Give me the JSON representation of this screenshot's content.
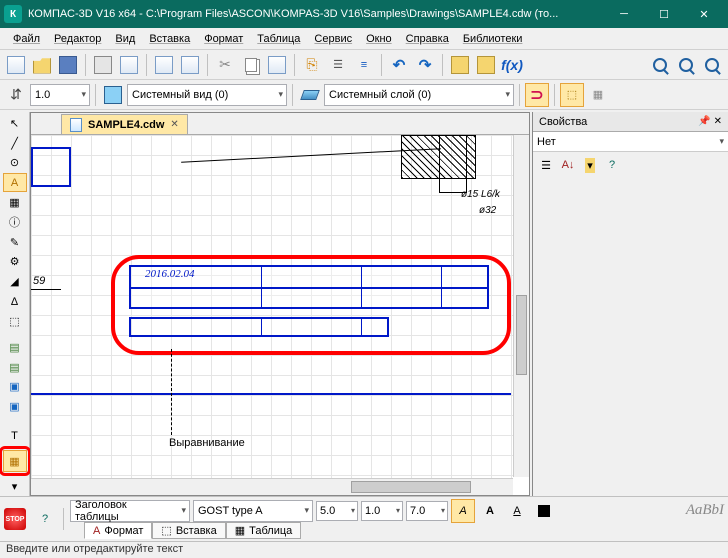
{
  "titlebar": {
    "title": "КОМПАС-3D V16  x64 - C:\\Program Files\\ASCON\\KOMPAS-3D V16\\Samples\\Drawings\\SAMPLE4.cdw (то..."
  },
  "menu": {
    "file": "Файл",
    "editor": "Редактор",
    "view": "Вид",
    "insert": "Вставка",
    "format": "Формат",
    "table": "Таблица",
    "service": "Сервис",
    "window": "Окно",
    "help": "Справка",
    "libraries": "Библиотеки"
  },
  "toolbar2": {
    "scale": "1.0",
    "view_name": "Системный вид (0)",
    "layer_name": "Системный слой (0)"
  },
  "doctab": {
    "name": "SAMPLE4.cdw"
  },
  "canvas": {
    "date_text": "2016.02.04",
    "dim_label": "59",
    "align_label": "Выравнивание",
    "dim1": "ø15 L6/k",
    "dim2": "ø32"
  },
  "props": {
    "title": "Свойства",
    "filter": "Нет"
  },
  "bottombar": {
    "section": "Заголовок таблицы",
    "font": "GOST type A",
    "size": "5.0",
    "spacing": "1.0",
    "width": "7.0",
    "style_preview": "АаBbI",
    "tab_format": "Формат",
    "tab_insert": "Вставка",
    "tab_table": "Таблица"
  },
  "statusbar": {
    "hint": "Введите или отредактируйте текст"
  }
}
